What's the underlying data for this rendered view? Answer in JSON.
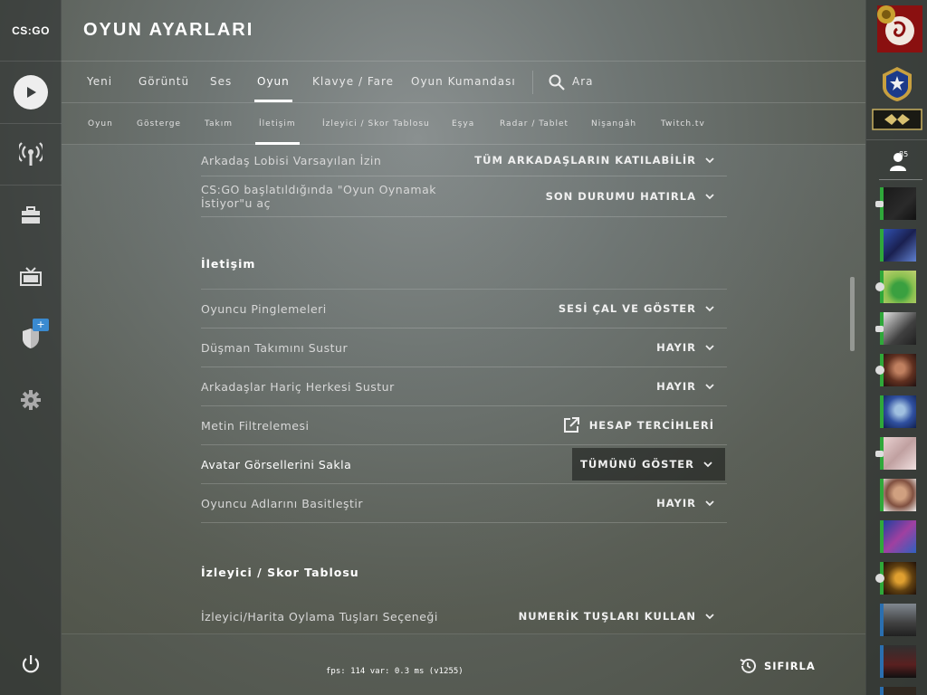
{
  "app": {
    "logo": "CS:GO",
    "title": "OYUN AYARLARI"
  },
  "colors": {
    "online": "#2fa83a",
    "ingame": "#2a6fb0",
    "accent": "#3a8ad0"
  },
  "sidebar_left": [
    {
      "icon": "play-icon"
    },
    {
      "icon": "broadcast-icon"
    },
    {
      "icon": "briefcase-icon"
    },
    {
      "icon": "tv-icon"
    },
    {
      "icon": "shield-icon",
      "badge": "+"
    },
    {
      "icon": "gear-icon"
    },
    {
      "icon": "power-icon"
    }
  ],
  "tabs": [
    {
      "label": "Yeni"
    },
    {
      "label": "Görüntü"
    },
    {
      "label": "Ses"
    },
    {
      "label": "Oyun",
      "active": true
    },
    {
      "label": "Klavye / Fare"
    },
    {
      "label": "Oyun Kumandası"
    }
  ],
  "search": {
    "label": "Ara"
  },
  "subtabs": [
    {
      "label": "Oyun"
    },
    {
      "label": "Gösterge"
    },
    {
      "label": "Takım"
    },
    {
      "label": "İletişim",
      "active": true
    },
    {
      "label": "İzleyici / Skor Tablosu"
    },
    {
      "label": "Eşya"
    },
    {
      "label": "Radar / Tablet"
    },
    {
      "label": "Nişangâh"
    },
    {
      "label": "Twitch.tv"
    }
  ],
  "settings": {
    "top": [
      {
        "label": "Arkadaş Lobisi Varsayılan İzin",
        "value": "TÜM ARKADAŞLARIN KATILABİLİR"
      },
      {
        "label": "CS:GO başlatıldığında \"Oyun Oynamak İstiyor\"u aç",
        "value": "SON DURUMU HATIRLA"
      }
    ],
    "section_comm": "İletişim",
    "comm": [
      {
        "label": "Oyuncu Pinglemeleri",
        "value": "SESİ ÇAL VE GÖSTER"
      },
      {
        "label": "Düşman Takımını Sustur",
        "value": "HAYIR"
      },
      {
        "label": "Arkadaşlar Hariç Herkesi Sustur",
        "value": "HAYIR"
      },
      {
        "label": "Metin Filtrelemesi",
        "value": "HESAP TERCİHLERİ"
      },
      {
        "label": "Avatar Görsellerini Sakla",
        "value": "TÜMÜNÜ GÖSTER"
      },
      {
        "label": "Oyuncu Adlarını Basitleştir",
        "value": "HAYIR"
      }
    ],
    "section_spec": "İzleyici / Skor Tablosu",
    "spec": [
      {
        "label": "İzleyici/Harita Oylama Tuşları Seçeneği",
        "value": "NUMERİK TUŞLARI KULLAN"
      }
    ]
  },
  "footer": {
    "fps": "fps:   114 var:  0.3 ms (v1255)",
    "reset": "SIFIRLA"
  },
  "friends": {
    "count": "85"
  }
}
